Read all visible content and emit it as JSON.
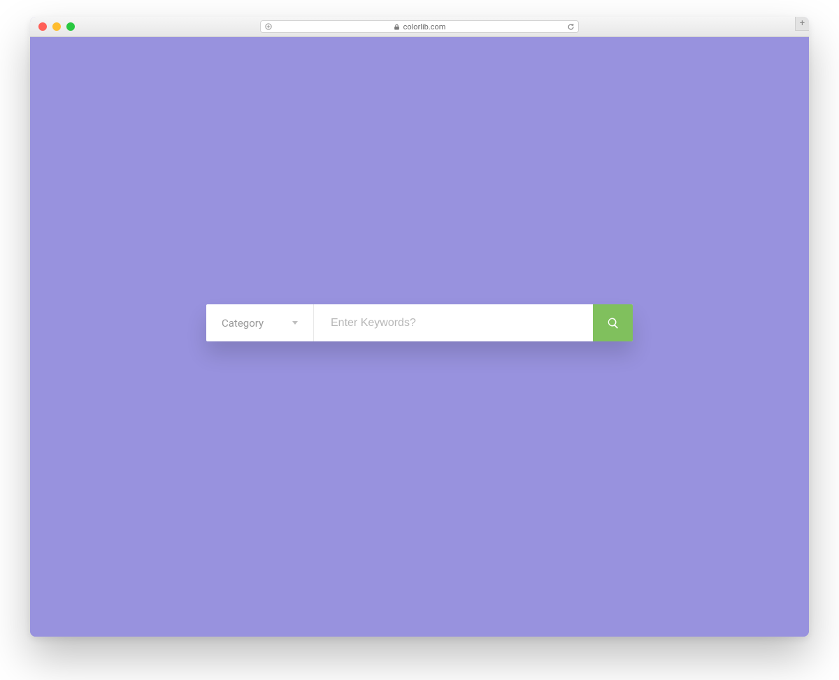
{
  "browser": {
    "address": "colorlib.com"
  },
  "search": {
    "category_label": "Category",
    "keywords_placeholder": "Enter Keywords?"
  },
  "colors": {
    "page_bg": "#9892de",
    "button_bg": "#80c05d"
  }
}
